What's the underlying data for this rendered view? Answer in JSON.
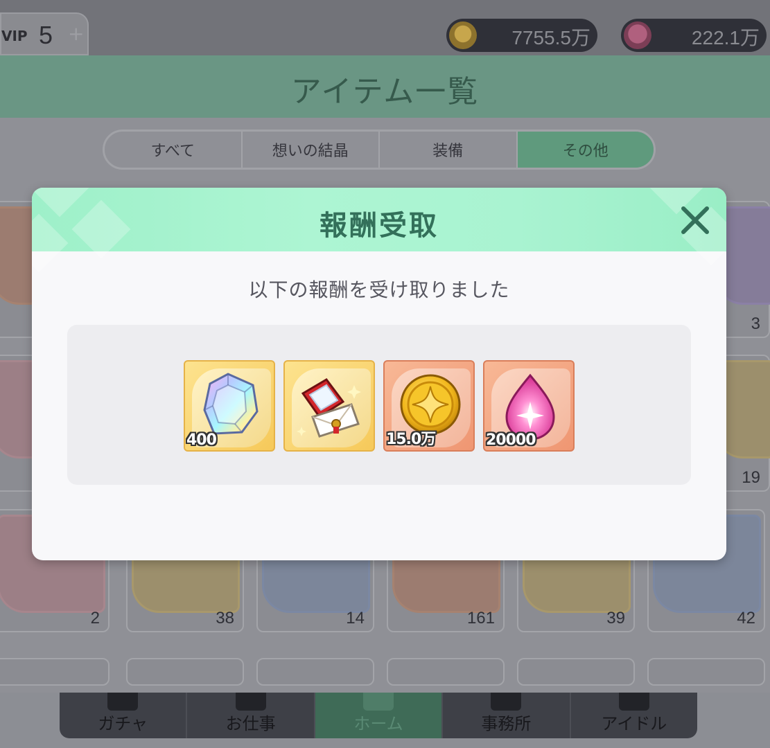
{
  "header": {
    "vip_label": "VIP",
    "vip_level": "5",
    "vip_plus": "+",
    "coin_amount": "7755.5万",
    "gem_amount": "222.1万"
  },
  "screen": {
    "title": "アイテム一覧",
    "tabs": [
      {
        "label": "すべて"
      },
      {
        "label": "想いの結晶"
      },
      {
        "label": "装備"
      },
      {
        "label": "その他"
      }
    ],
    "active_tab": "その他"
  },
  "inventory": {
    "visible_counts_row1": [
      "3"
    ],
    "visible_counts_row2": [
      "19"
    ],
    "visible_counts_row3": [
      "2",
      "38",
      "14",
      "161",
      "39",
      "42"
    ]
  },
  "navbar": {
    "items": [
      {
        "label": "ガチャ"
      },
      {
        "label": "お仕事"
      },
      {
        "label": "ホーム"
      },
      {
        "label": "事務所"
      },
      {
        "label": "アイドル"
      }
    ],
    "active": "ホーム"
  },
  "modal": {
    "title": "報酬受取",
    "message": "以下の報酬を受け取りました",
    "close_icon": "close-icon",
    "rewards": [
      {
        "item": "rainbow-crystal-icon",
        "quantity": "400",
        "frame": "gold"
      },
      {
        "item": "gift-box-letter-icon",
        "quantity": "",
        "frame": "gold"
      },
      {
        "item": "gold-coin-icon",
        "quantity": "15.0万",
        "frame": "orange"
      },
      {
        "item": "pink-gem-icon",
        "quantity": "20000",
        "frame": "orange"
      }
    ]
  },
  "colors": {
    "modal_header": "#a9f3d1",
    "modal_title": "#33705a",
    "close_icon": "#33705a",
    "reward_gold_frame": "#f6c95a",
    "reward_orange_frame": "#ef9672"
  }
}
